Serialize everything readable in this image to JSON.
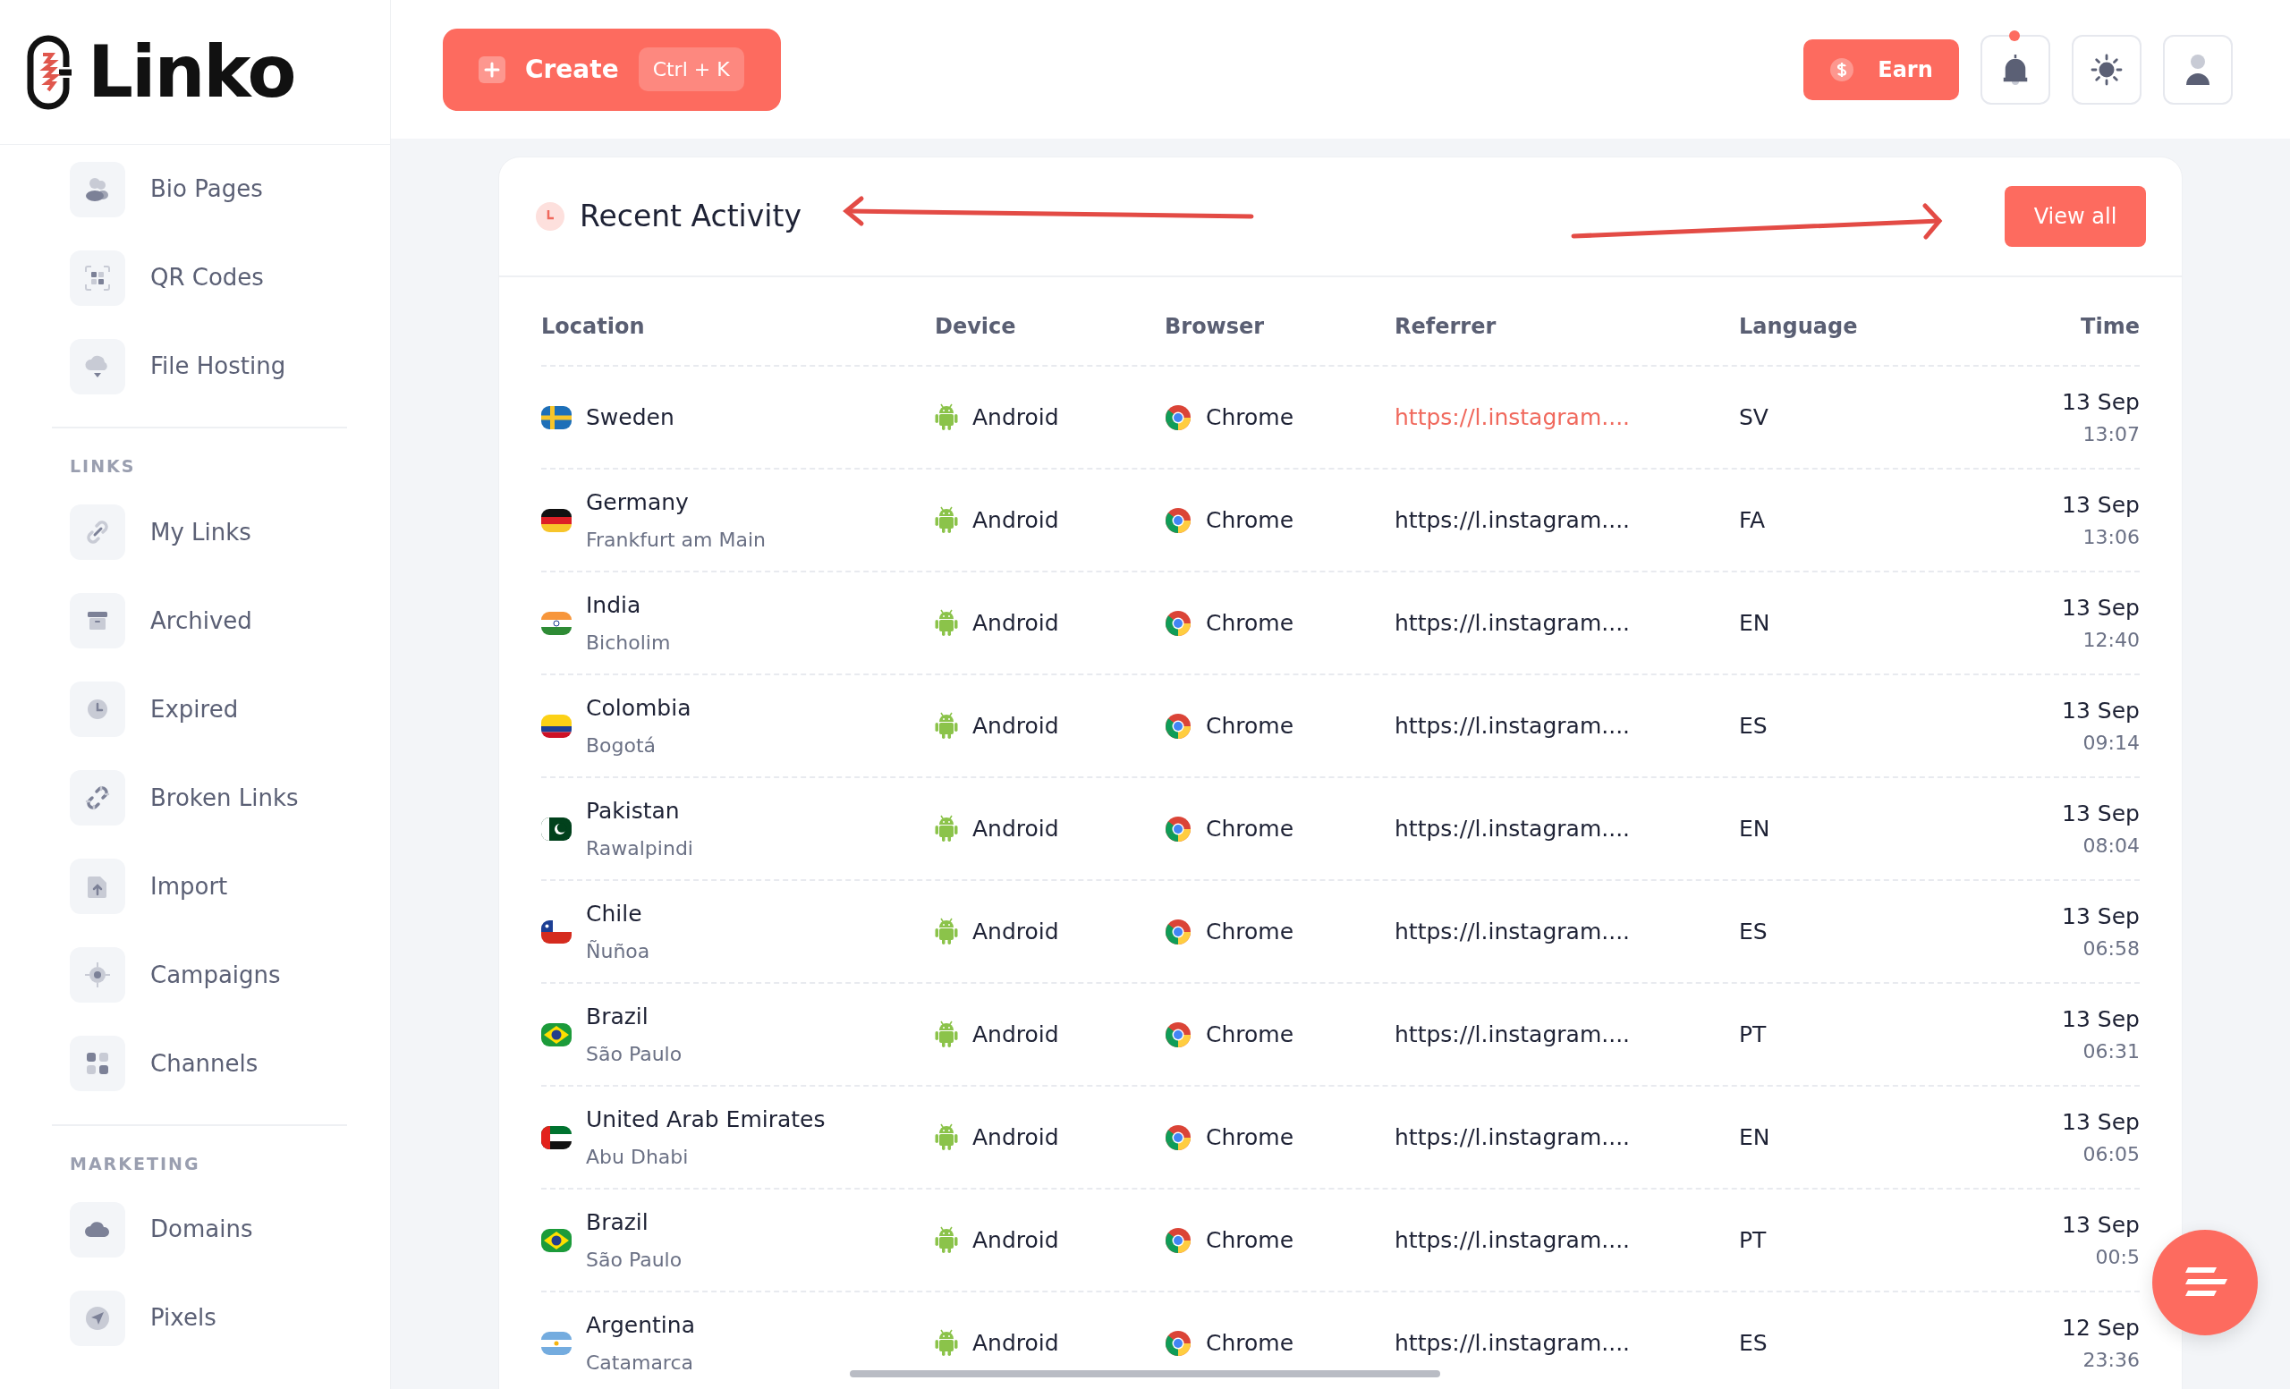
{
  "logo": {
    "text": "Linko"
  },
  "header": {
    "create": {
      "label": "Create",
      "shortcut": "Ctrl + K"
    },
    "earn": {
      "label": "Earn"
    },
    "notifications": {
      "unread": true
    }
  },
  "sidebar": {
    "sections": [
      {
        "items": [
          {
            "label": "Bio Pages"
          },
          {
            "label": "QR Codes"
          },
          {
            "label": "File Hosting"
          }
        ]
      },
      {
        "title": "LINKS",
        "items": [
          {
            "label": "My Links"
          },
          {
            "label": "Archived"
          },
          {
            "label": "Expired"
          },
          {
            "label": "Broken Links"
          },
          {
            "label": "Import"
          },
          {
            "label": "Campaigns"
          },
          {
            "label": "Channels"
          }
        ]
      },
      {
        "title": "MARKETING",
        "items": [
          {
            "label": "Domains"
          },
          {
            "label": "Pixels"
          }
        ]
      }
    ]
  },
  "activity": {
    "title": "Recent Activity",
    "view_all": "View all",
    "columns": [
      "Location",
      "Device",
      "Browser",
      "Referrer",
      "Language",
      "Time"
    ],
    "rows": [
      {
        "kind": "se",
        "country": "Sweden",
        "device": "Android",
        "browser": "Chrome",
        "referrer": "https://l.instagram....",
        "hovered": true,
        "language": "SV",
        "date": "13 Sep",
        "time": "13:07"
      },
      {
        "kind": "de",
        "country": "Germany",
        "city": "Frankfurt am Main",
        "device": "Android",
        "browser": "Chrome",
        "referrer": "https://l.instagram....",
        "hovered": false,
        "language": "FA",
        "date": "13 Sep",
        "time": "13:06"
      },
      {
        "kind": "in",
        "country": "India",
        "city": "Bicholim",
        "device": "Android",
        "browser": "Chrome",
        "referrer": "https://l.instagram....",
        "hovered": false,
        "language": "EN",
        "date": "13 Sep",
        "time": "12:40"
      },
      {
        "kind": "co",
        "country": "Colombia",
        "city": "Bogotá",
        "device": "Android",
        "browser": "Chrome",
        "referrer": "https://l.instagram....",
        "hovered": false,
        "language": "ES",
        "date": "13 Sep",
        "time": "09:14"
      },
      {
        "kind": "pk",
        "country": "Pakistan",
        "city": "Rawalpindi",
        "device": "Android",
        "browser": "Chrome",
        "referrer": "https://l.instagram....",
        "hovered": false,
        "language": "EN",
        "date": "13 Sep",
        "time": "08:04"
      },
      {
        "kind": "cl",
        "country": "Chile",
        "city": "Ñuñoa",
        "device": "Android",
        "browser": "Chrome",
        "referrer": "https://l.instagram....",
        "hovered": false,
        "language": "ES",
        "date": "13 Sep",
        "time": "06:58"
      },
      {
        "kind": "br",
        "country": "Brazil",
        "city": "São Paulo",
        "device": "Android",
        "browser": "Chrome",
        "referrer": "https://l.instagram....",
        "hovered": false,
        "language": "PT",
        "date": "13 Sep",
        "time": "06:31"
      },
      {
        "kind": "ae",
        "country": "United Arab Emirates",
        "city": "Abu Dhabi",
        "device": "Android",
        "browser": "Chrome",
        "referrer": "https://l.instagram....",
        "hovered": false,
        "language": "EN",
        "date": "13 Sep",
        "time": "06:05"
      },
      {
        "kind": "br",
        "country": "Brazil",
        "city": "São Paulo",
        "device": "Android",
        "browser": "Chrome",
        "referrer": "https://l.instagram....",
        "hovered": false,
        "language": "PT",
        "date": "13 Sep",
        "time": "00:5"
      },
      {
        "kind": "ar",
        "country": "Argentina",
        "city": "Catamarca",
        "device": "Android",
        "browser": "Chrome",
        "referrer": "https://l.instagram....",
        "hovered": false,
        "language": "ES",
        "date": "12 Sep",
        "time": "23:36"
      }
    ]
  }
}
